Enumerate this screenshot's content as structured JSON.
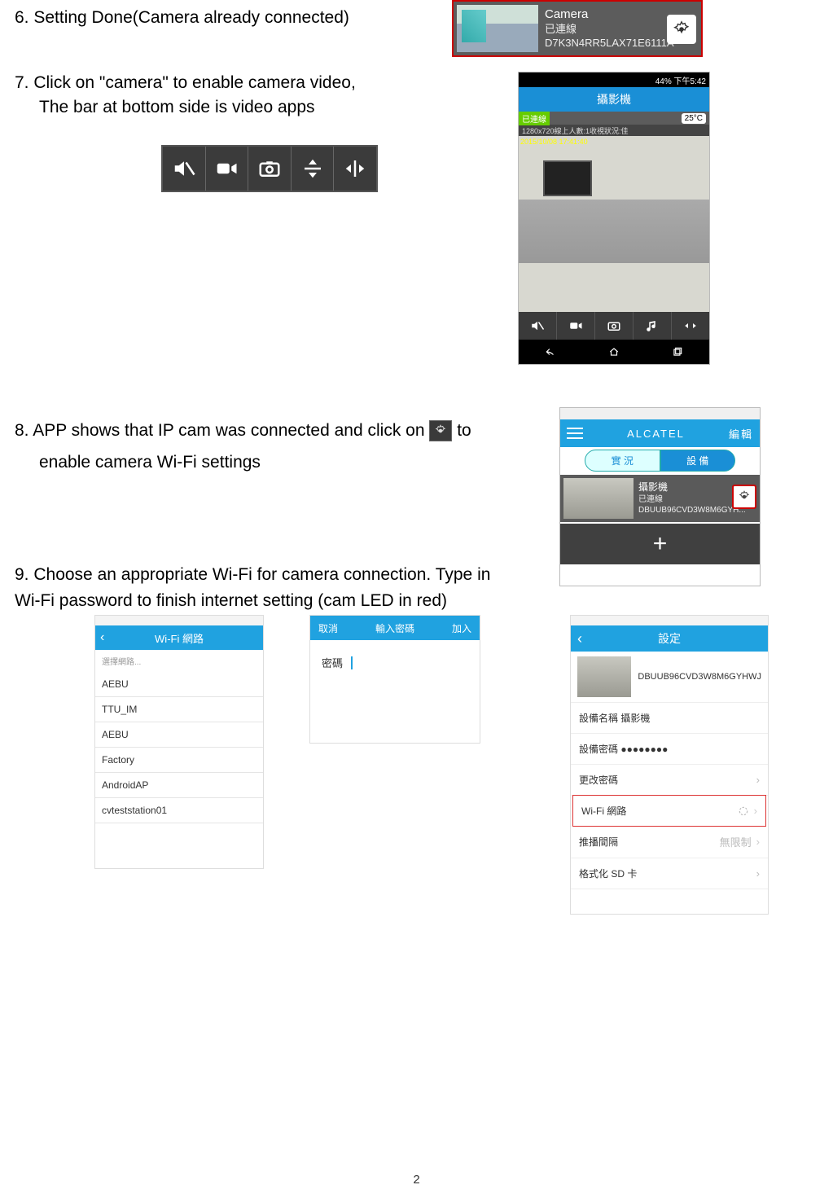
{
  "steps": {
    "s6": "6.  Setting Done(Camera already connected)",
    "s7": "7.  Click on \"camera\" to enable camera video,",
    "s7_sub": "The bar at bottom side is video apps",
    "s8_pre": "8.  APP shows that IP cam was connected and click on ",
    "s8_post": " to",
    "s8_sub": "enable camera Wi-Fi settings",
    "s9a": "9. Choose an appropriate Wi-Fi for camera connection. Type in",
    "s9b": "Wi-Fi password to finish internet setting (cam LED in red)"
  },
  "cam_card": {
    "title": "Camera",
    "status": "已連線",
    "id": "D7K3N4RR5LAX71E6111A"
  },
  "phone7": {
    "status_right": "44%   下午5:42",
    "header": "攝影機",
    "badge": "已連線",
    "temp": "25°C",
    "meta": "1280x720線上人數:1收視狀況:佳",
    "timestamp": "2015/10/08 17:41:40"
  },
  "phone8": {
    "brand": "ALCATEL",
    "edit": "編輯",
    "tab_live": "實 況",
    "tab_dev": "設 備",
    "cam_title": "攝影機",
    "cam_status": "已連線",
    "cam_id": "DBUUB96CVD3W8M6GYH...",
    "add": "+"
  },
  "wifi_list": {
    "title": "Wi-Fi 網路",
    "hint": "選擇網路...",
    "items": [
      "AEBU",
      "TTU_IM",
      "AEBU",
      "Factory",
      "AndroidAP",
      "cvteststation01"
    ]
  },
  "pw_dialog": {
    "cancel": "取消",
    "title": "輸入密碼",
    "join": "加入",
    "label": "密碼"
  },
  "settings": {
    "title": "設定",
    "device_id": "DBUUB96CVD3W8M6GYHWJ",
    "rows": {
      "name_label": "設備名稱 攝影機",
      "pw_label": "設備密碼 ●●●●●●●●",
      "change_pw": "更改密碼",
      "wifi": "Wi-Fi 網路",
      "push": "推播間隔",
      "push_val": "無限制",
      "sd": "格式化 SD 卡"
    }
  },
  "page_number": "2"
}
